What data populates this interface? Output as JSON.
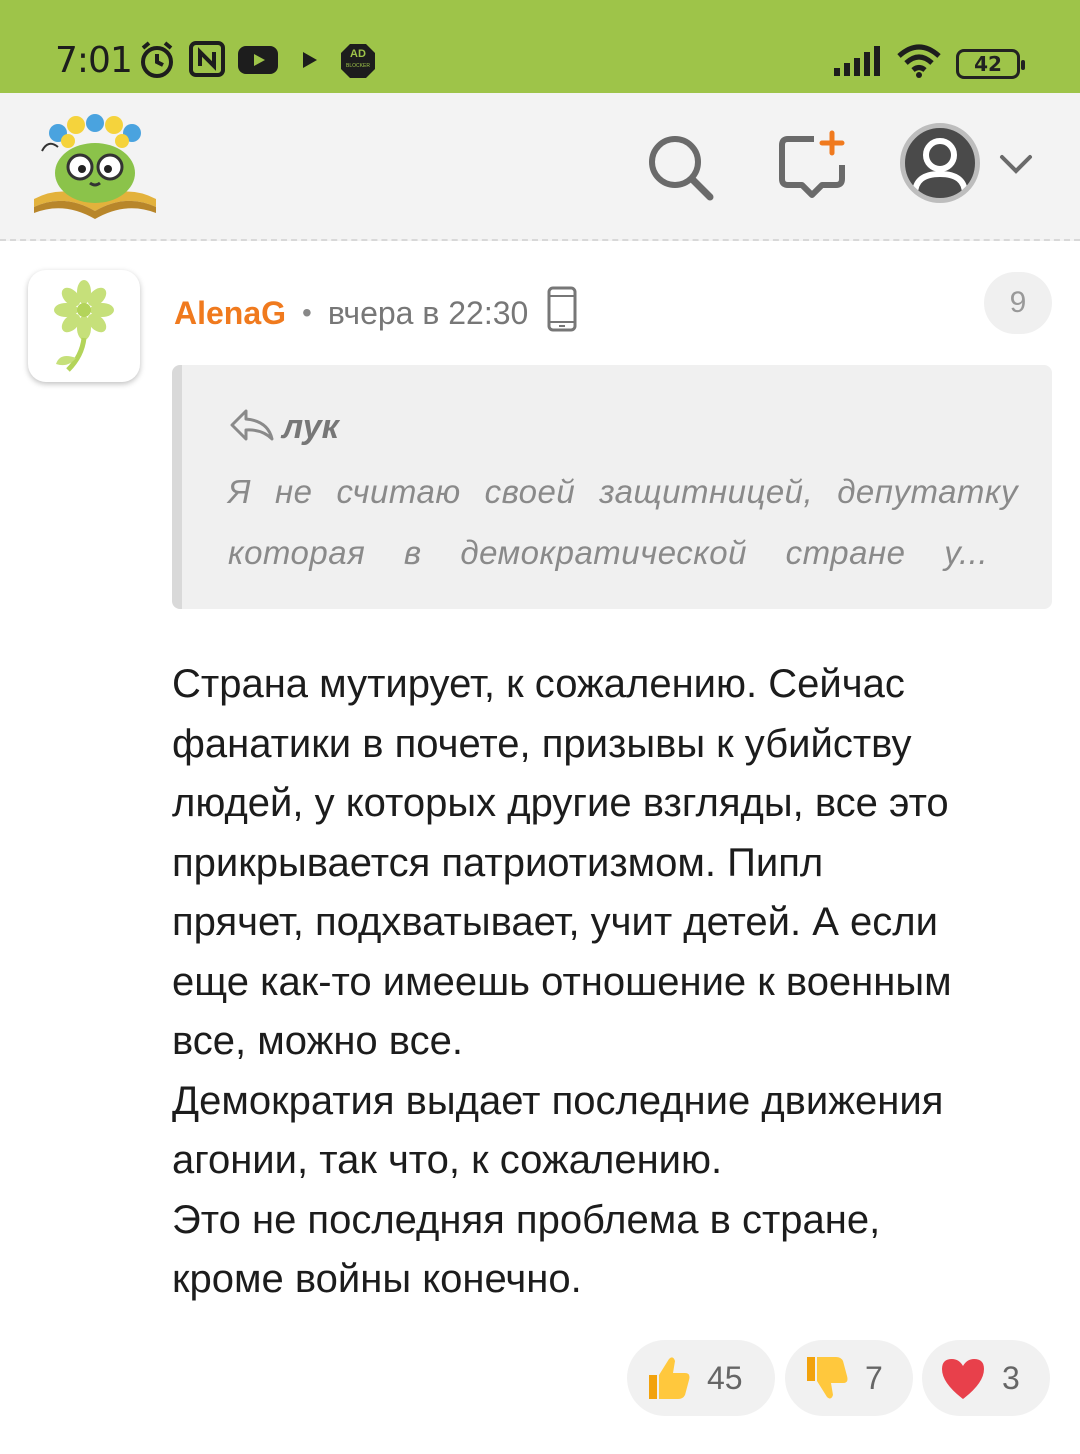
{
  "status_bar": {
    "time": "7:01",
    "battery": "42",
    "icons": [
      "alarm-icon",
      "nfc-icon",
      "youtube-icon",
      "play-icon",
      "adblocker-icon",
      "signal-icon",
      "wifi-icon",
      "battery-icon"
    ],
    "adblock_label": "AD",
    "adblock_sublabel": "BLOCKER"
  },
  "header": {
    "background": "#f3f3f3",
    "icons": [
      "site-logo",
      "search-icon",
      "new-post-icon",
      "user-avatar-icon",
      "chevron-down-icon"
    ]
  },
  "comment": {
    "author": "AlenaG",
    "separator": "•",
    "time": "вчера в 22:30",
    "number": "9",
    "quote": {
      "author": "лук",
      "line1": "Я не считаю своей защитницей, депутатку",
      "line2": "которая в демократической стране у..."
    },
    "body": [
      "Страна мутирует, к сожалению. Сейчас",
      "фанатики в почете, призывы к убийству",
      "людей, у которых другие взгляды, все это",
      "прикрывается патриотизмом. Пипл",
      "прячет, подхватывает, учит детей. А если",
      "еще как-то имеешь отношение к военным",
      "все, можно все.",
      "Демократия выдает последние движения",
      "агонии, так что, к сожалению.",
      "Это не последняя проблема в стране,",
      "кроме войны конечно."
    ],
    "reactions": {
      "like_count": "45",
      "dislike_count": "7",
      "heart_count": "3"
    }
  },
  "colors": {
    "status_bar": "#9ec449",
    "author": "#f07a1e",
    "quote_bg": "#f0f0f0"
  }
}
